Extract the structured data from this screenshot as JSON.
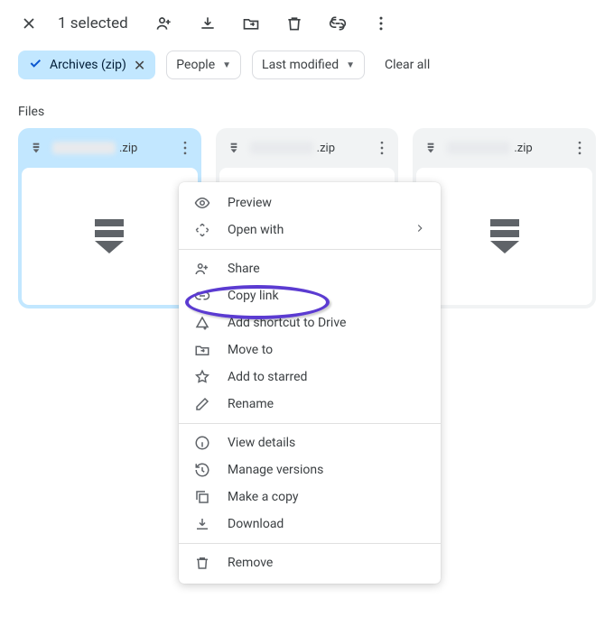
{
  "toolbar": {
    "selected_text": "1 selected"
  },
  "filters": {
    "type_chip": "Archives (zip)",
    "people_chip": "People",
    "modified_chip": "Last modified",
    "clear_all": "Clear all"
  },
  "section_label": "Files",
  "files": [
    {
      "ext": ".zip",
      "selected": true
    },
    {
      "ext": ".zip",
      "selected": false
    },
    {
      "ext": ".zip",
      "selected": false
    }
  ],
  "menu": {
    "preview": "Preview",
    "open_with": "Open with",
    "share": "Share",
    "copy_link": "Copy link",
    "add_shortcut": "Add shortcut to Drive",
    "move_to": "Move to",
    "add_starred": "Add to starred",
    "rename": "Rename",
    "view_details": "View details",
    "manage_versions": "Manage versions",
    "make_copy": "Make a copy",
    "download": "Download",
    "remove": "Remove"
  }
}
